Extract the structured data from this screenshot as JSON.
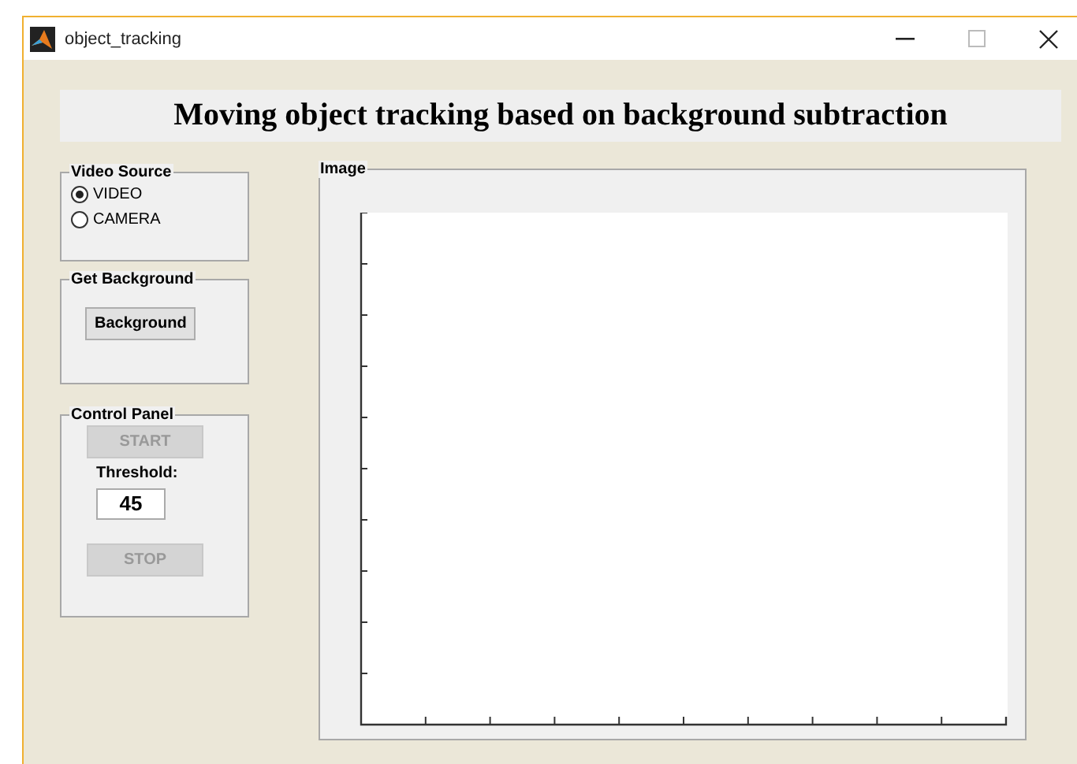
{
  "window": {
    "title": "object_tracking"
  },
  "heading": "Moving object tracking based on background subtraction",
  "video_source": {
    "title": "Video Source",
    "options": [
      {
        "label": "VIDEO",
        "selected": true
      },
      {
        "label": "CAMERA",
        "selected": false
      }
    ]
  },
  "get_background": {
    "title": "Get Background",
    "button": {
      "label": "Background",
      "disabled": false
    }
  },
  "control_panel": {
    "title": "Control Panel",
    "start_button": {
      "label": "START",
      "disabled": true
    },
    "threshold_label": "Threshold:",
    "threshold_value": "45",
    "stop_button": {
      "label": "STOP",
      "disabled": true
    }
  },
  "image_panel": {
    "title": "Image"
  }
}
